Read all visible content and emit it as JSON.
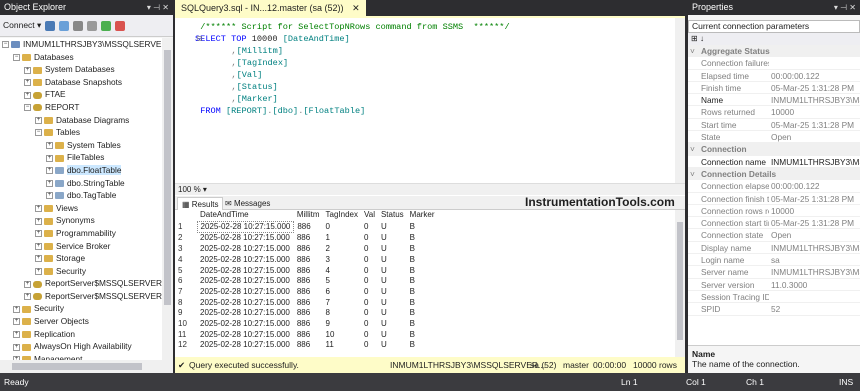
{
  "object_explorer": {
    "title": "Object Explorer",
    "pin": "▾ ⊣ ✕",
    "connect_label": "Connect ▾",
    "tree": [
      {
        "label": "INMUM1LTHRSJBY3\\MSSQLSERVER20",
        "icon": "server-icon",
        "exp": "−",
        "indent": 0
      },
      {
        "label": "Databases",
        "icon": "folder-icon",
        "exp": "−",
        "indent": 1
      },
      {
        "label": "System Databases",
        "icon": "folder-icon",
        "exp": "+",
        "indent": 2
      },
      {
        "label": "Database Snapshots",
        "icon": "folder-icon",
        "exp": "+",
        "indent": 2
      },
      {
        "label": "FTAE",
        "icon": "database-icon",
        "exp": "+",
        "indent": 2
      },
      {
        "label": "REPORT",
        "icon": "database-icon",
        "exp": "−",
        "indent": 2
      },
      {
        "label": "Database Diagrams",
        "icon": "folder-icon",
        "exp": "+",
        "indent": 3
      },
      {
        "label": "Tables",
        "icon": "folder-icon",
        "exp": "−",
        "indent": 3
      },
      {
        "label": "System Tables",
        "icon": "folder-icon",
        "exp": "+",
        "indent": 4
      },
      {
        "label": "FileTables",
        "icon": "folder-icon",
        "exp": "+",
        "indent": 4
      },
      {
        "label": "dbo.FloatTable",
        "icon": "table-icon",
        "exp": "+",
        "indent": 4,
        "selected": true
      },
      {
        "label": "dbo.StringTable",
        "icon": "table-icon",
        "exp": "+",
        "indent": 4
      },
      {
        "label": "dbo.TagTable",
        "icon": "table-icon",
        "exp": "+",
        "indent": 4
      },
      {
        "label": "Views",
        "icon": "folder-icon",
        "exp": "+",
        "indent": 3
      },
      {
        "label": "Synonyms",
        "icon": "folder-icon",
        "exp": "+",
        "indent": 3
      },
      {
        "label": "Programmability",
        "icon": "folder-icon",
        "exp": "+",
        "indent": 3
      },
      {
        "label": "Service Broker",
        "icon": "folder-icon",
        "exp": "+",
        "indent": 3
      },
      {
        "label": "Storage",
        "icon": "folder-icon",
        "exp": "+",
        "indent": 3
      },
      {
        "label": "Security",
        "icon": "folder-icon",
        "exp": "+",
        "indent": 3
      },
      {
        "label": "ReportServer$MSSQLSERVER2012",
        "icon": "database-icon",
        "exp": "+",
        "indent": 2
      },
      {
        "label": "ReportServer$MSSQLSERVER2012",
        "icon": "database-icon",
        "exp": "+",
        "indent": 2
      },
      {
        "label": "Security",
        "icon": "folder-icon",
        "exp": "+",
        "indent": 1
      },
      {
        "label": "Server Objects",
        "icon": "folder-icon",
        "exp": "+",
        "indent": 1
      },
      {
        "label": "Replication",
        "icon": "folder-icon",
        "exp": "+",
        "indent": 1
      },
      {
        "label": "AlwaysOn High Availability",
        "icon": "folder-icon",
        "exp": "+",
        "indent": 1
      },
      {
        "label": "Management",
        "icon": "folder-icon",
        "exp": "+",
        "indent": 1
      }
    ]
  },
  "query": {
    "tab_label": "SQLQuery3.sql - IN...12.master (sa (52))",
    "tab_close": "✕",
    "lines": [
      {
        "parts": [
          {
            "t": "/****** Script for SelectTopNRows command from SSMS  ******/",
            "c": "cm"
          }
        ],
        "indent": 1
      },
      {
        "parts": [
          {
            "t": "SELECT TOP ",
            "c": "kw"
          },
          {
            "t": "10000 ",
            "c": ""
          },
          {
            "t": "[DateAndTime]",
            "c": "id"
          }
        ],
        "indent": 0,
        "fold": "⊟"
      },
      {
        "parts": [
          {
            "t": ",",
            "c": "gr"
          },
          {
            "t": "[Millitm]",
            "c": "id"
          }
        ],
        "indent": 7
      },
      {
        "parts": [
          {
            "t": ",",
            "c": "gr"
          },
          {
            "t": "[TagIndex]",
            "c": "id"
          }
        ],
        "indent": 7
      },
      {
        "parts": [
          {
            "t": ",",
            "c": "gr"
          },
          {
            "t": "[Val]",
            "c": "id"
          }
        ],
        "indent": 7
      },
      {
        "parts": [
          {
            "t": ",",
            "c": "gr"
          },
          {
            "t": "[Status]",
            "c": "id"
          }
        ],
        "indent": 7
      },
      {
        "parts": [
          {
            "t": ",",
            "c": "gr"
          },
          {
            "t": "[Marker]",
            "c": "id"
          }
        ],
        "indent": 7
      },
      {
        "parts": [
          {
            "t": "FROM ",
            "c": "kw"
          },
          {
            "t": "[REPORT]",
            "c": "id"
          },
          {
            "t": ".",
            "c": "gr"
          },
          {
            "t": "[dbo]",
            "c": "id"
          },
          {
            "t": ".",
            "c": "gr"
          },
          {
            "t": "[FloatTable]",
            "c": "id"
          }
        ],
        "indent": 1
      }
    ],
    "zoom": "100 %",
    "tabs": {
      "results": "Results",
      "messages": "Messages"
    },
    "watermark": "InstrumentationTools.com",
    "columns": [
      "DateAndTime",
      "Millitm",
      "TagIndex",
      "Val",
      "Status",
      "Marker"
    ],
    "rows": [
      [
        "1",
        "2025-02-28 10:27:15.000",
        "886",
        "0",
        "0",
        "U",
        "B"
      ],
      [
        "2",
        "2025-02-28 10:27:15.000",
        "886",
        "1",
        "0",
        "U",
        "B"
      ],
      [
        "3",
        "2025-02-28 10:27:15.000",
        "886",
        "2",
        "0",
        "U",
        "B"
      ],
      [
        "4",
        "2025-02-28 10:27:15.000",
        "886",
        "3",
        "0",
        "U",
        "B"
      ],
      [
        "5",
        "2025-02-28 10:27:15.000",
        "886",
        "4",
        "0",
        "U",
        "B"
      ],
      [
        "6",
        "2025-02-28 10:27:15.000",
        "886",
        "5",
        "0",
        "U",
        "B"
      ],
      [
        "7",
        "2025-02-28 10:27:15.000",
        "886",
        "6",
        "0",
        "U",
        "B"
      ],
      [
        "8",
        "2025-02-28 10:27:15.000",
        "886",
        "7",
        "0",
        "U",
        "B"
      ],
      [
        "9",
        "2025-02-28 10:27:15.000",
        "886",
        "8",
        "0",
        "U",
        "B"
      ],
      [
        "10",
        "2025-02-28 10:27:15.000",
        "886",
        "9",
        "0",
        "U",
        "B"
      ],
      [
        "11",
        "2025-02-28 10:27:15.000",
        "886",
        "10",
        "0",
        "U",
        "B"
      ],
      [
        "12",
        "2025-02-28 10:27:15.000",
        "886",
        "11",
        "0",
        "U",
        "B"
      ]
    ],
    "status": {
      "message": "Query executed successfully.",
      "server": "INMUM1LTHRSJBY3\\MSSQLSERVER...",
      "user": "sa (52)",
      "db": "master",
      "time": "00:00:00",
      "rows": "10000 rows"
    }
  },
  "properties": {
    "title": "Properties",
    "pin": "▾ ⊣ ✕",
    "combo": "Current connection parameters",
    "rows": [
      {
        "cat": "Aggregate Status"
      },
      {
        "k": "Connection failures",
        "v": ""
      },
      {
        "k": "Elapsed time",
        "v": "00:00:00.122"
      },
      {
        "k": "Finish time",
        "v": "05-Mar-25 1:31:28 PM"
      },
      {
        "k": "Name",
        "v": "INMUM1LTHRSJBY3\\MSSQLSERVER"
      },
      {
        "k": "Rows returned",
        "v": "10000"
      },
      {
        "k": "Start time",
        "v": "05-Mar-25 1:31:28 PM"
      },
      {
        "k": "State",
        "v": "Open"
      },
      {
        "cat": "Connection"
      },
      {
        "k": "Connection name",
        "v": "INMUM1LTHRSJBY3\\MSSQLSERVER",
        "hi": true
      },
      {
        "cat": "Connection Details"
      },
      {
        "k": "Connection elapsed",
        "v": "00:00:00.122"
      },
      {
        "k": "Connection finish time",
        "v": "05-Mar-25 1:31:28 PM"
      },
      {
        "k": "Connection rows returned",
        "v": "10000"
      },
      {
        "k": "Connection start time",
        "v": "05-Mar-25 1:31:28 PM"
      },
      {
        "k": "Connection state",
        "v": "Open"
      },
      {
        "k": "Display name",
        "v": "INMUM1LTHRSJBY3\\MSSQLSERVER"
      },
      {
        "k": "Login name",
        "v": "sa"
      },
      {
        "k": "Server name",
        "v": "INMUM1LTHRSJBY3\\MSSQLSERVER"
      },
      {
        "k": "Server version",
        "v": "11.0.3000"
      },
      {
        "k": "Session Tracing ID",
        "v": ""
      },
      {
        "k": "SPID",
        "v": "52"
      }
    ],
    "desc_title": "Name",
    "desc_text": "The name of the connection."
  },
  "statusbar": {
    "ready": "Ready",
    "ln": "Ln 1",
    "col": "Col 1",
    "ch": "Ch 1",
    "ins": "INS"
  },
  "colors": {
    "chrome": "#2d2d30",
    "tab_active": "#fefcc8",
    "keyword": "#0000ff",
    "comment": "#008000",
    "identifier": "#008080"
  }
}
